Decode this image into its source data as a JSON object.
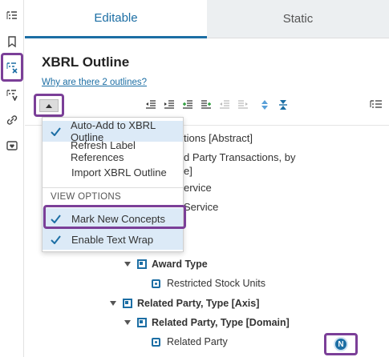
{
  "tabs": [
    {
      "label": "Editable"
    },
    {
      "label": "Static"
    }
  ],
  "outline": {
    "title": "XBRL Outline",
    "link": "Why are there 2 outlines?"
  },
  "menu": {
    "items": [
      {
        "label": "Auto-Add to XBRL Outline",
        "checked": true
      },
      {
        "label": "Refresh Label References",
        "checked": false
      },
      {
        "label": "Import XBRL Outline",
        "checked": false
      }
    ],
    "section_header": "VIEW OPTIONS",
    "view_options": [
      {
        "label": "Mark New Concepts",
        "checked": true
      },
      {
        "label": "Enable Text Wrap",
        "checked": true
      }
    ]
  },
  "tree": {
    "partial": [
      "tions [Abstract]",
      "d Party Transactions, by",
      "e]",
      "ervice",
      "Service"
    ],
    "nodes": [
      {
        "label": "Award Type",
        "kind": "member-group"
      },
      {
        "label": "Restricted Stock Units",
        "kind": "member"
      },
      {
        "label": "Related Party, Type [Axis]",
        "kind": "axis"
      },
      {
        "label": "Related Party, Type [Domain]",
        "kind": "domain"
      },
      {
        "label": "Related Party",
        "kind": "member"
      }
    ]
  },
  "badge": {
    "text": "N"
  },
  "colors": {
    "accent": "#1c6ea4",
    "highlight": "#7b3f98",
    "selected_row": "#dceaf7"
  }
}
